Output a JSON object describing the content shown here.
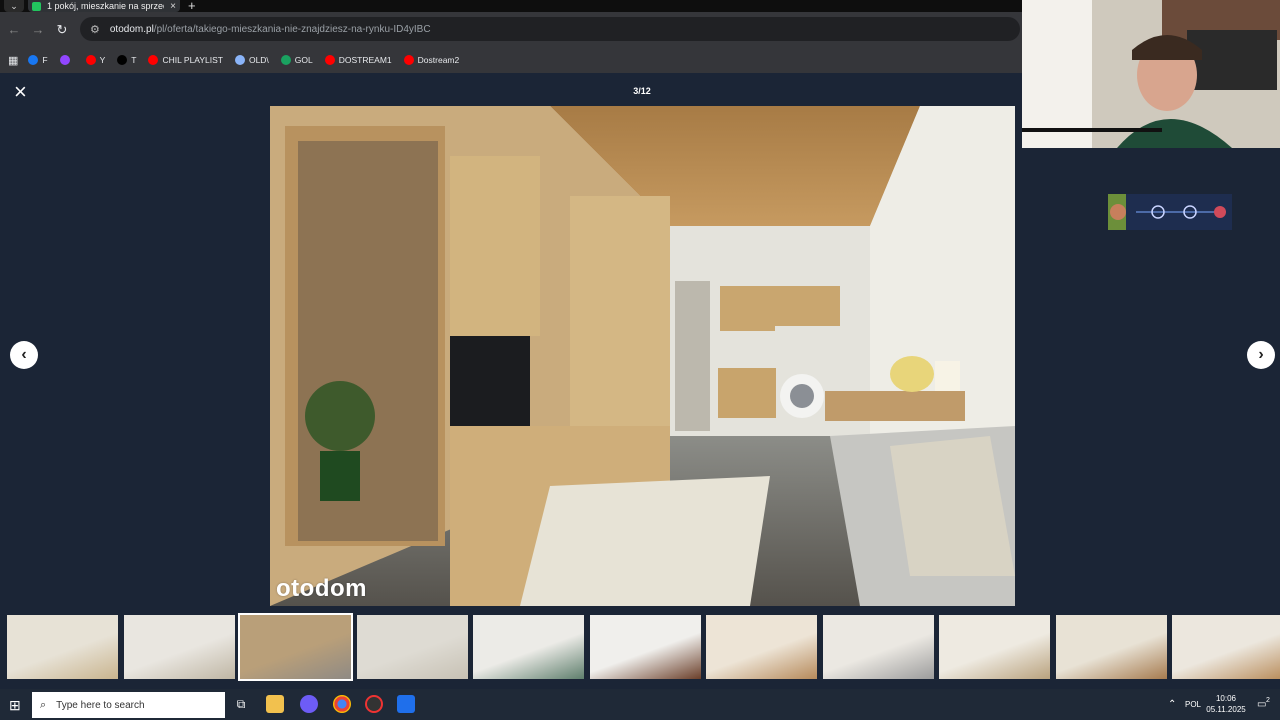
{
  "browser": {
    "tab_title": "1 pokój, mieszkanie na sprzeda",
    "tab_close": "×",
    "new_tab": "+",
    "url_domain": "otodom.pl",
    "url_path": "/pl/oferta/takiego-mieszkania-nie-znajdziesz-na-rynku-ID4yIBC",
    "bookmarks": [
      {
        "label": "F",
        "color": "#1877f2"
      },
      {
        "label": "",
        "color": "#9146ff"
      },
      {
        "label": "Y",
        "color": "#ff0000"
      },
      {
        "label": "T",
        "color": "#000000"
      },
      {
        "label": "CHIL PLAYLIST",
        "color": "#ff0000"
      },
      {
        "label": "OLD\\",
        "color": "#8ab4f8"
      },
      {
        "label": "GOL",
        "color": "#1aa260"
      },
      {
        "label": "DOSTREAM1",
        "color": "#ff0000"
      },
      {
        "label": "Dostream2",
        "color": "#ff0000"
      }
    ]
  },
  "gallery": {
    "close": "×",
    "counter": "3/12",
    "watermark": "otodom",
    "prev": "‹",
    "next": "›",
    "thumbs": [
      {
        "c1": "#e7e2d6",
        "c2": "#c9b48e"
      },
      {
        "c1": "#e9e6e0",
        "c2": "#bfb6a4"
      },
      {
        "c1": "#b99f79",
        "c2": "#8f8a84"
      },
      {
        "c1": "#dedbd3",
        "c2": "#c7c1b4"
      },
      {
        "c1": "#ecebe7",
        "c2": "#5f7f6d"
      },
      {
        "c1": "#f0efec",
        "c2": "#6b3f2a"
      },
      {
        "c1": "#ede4d6",
        "c2": "#b68a5b"
      },
      {
        "c1": "#ebe8e2",
        "c2": "#9c9c9c"
      },
      {
        "c1": "#eeeae1",
        "c2": "#b9a27e"
      },
      {
        "c1": "#e8e2d5",
        "c2": "#a67b4f"
      },
      {
        "c1": "#ece7de",
        "c2": "#b98d5c"
      }
    ]
  },
  "taskbar": {
    "search_placeholder": "Type here to search",
    "language": "POL",
    "time": "10:06",
    "date": "05.11.2025",
    "notifications": "2"
  }
}
